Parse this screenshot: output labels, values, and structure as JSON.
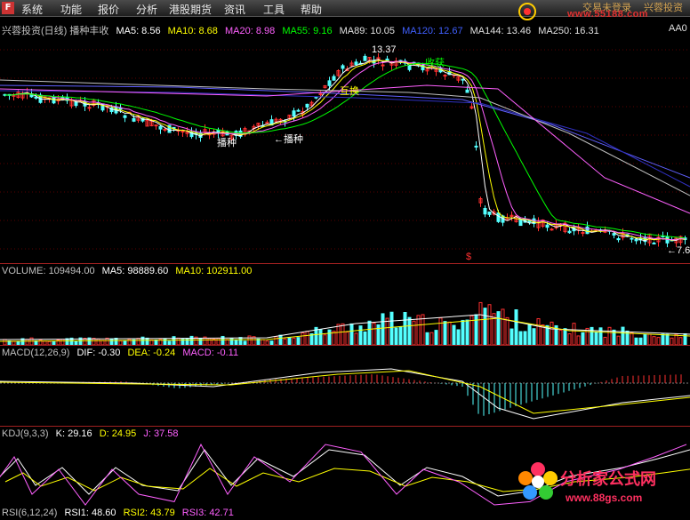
{
  "menu": {
    "logo_glyph": "F",
    "items": [
      "系统",
      "功能",
      "报价",
      "分析",
      "港股期货",
      "资讯",
      "工具",
      "帮助"
    ],
    "login_status": "交易未登录",
    "brand": "兴蓉投资"
  },
  "watermark_top_url": "www.55188.com",
  "price_legend": {
    "title": "兴蓉投资(日线) 播种丰收",
    "ma5": "MA5: 8.56",
    "ma10": "MA10: 8.68",
    "ma20": "MA20: 8.98",
    "ma55": "MA55: 9.16",
    "ma89": "MA89: 10.05",
    "ma120": "MA120: 12.67",
    "ma144": "MA144: 13.46",
    "ma250": "MA250: 16.31",
    "right_tag": "AA0"
  },
  "price_annotations": {
    "peak_price": "13.37",
    "harvest": "收获",
    "harvest2": "收获",
    "trade": "互换",
    "sow": "播种",
    "sow2": "←播种",
    "low_price": "←7.6"
  },
  "volume_legend": {
    "label": "VOLUME: 109494.00",
    "ma5": "MA5: 98889.60",
    "ma10": "MA10: 102911.00"
  },
  "macd_legend": {
    "label": "MACD(12,26,9)",
    "dif": "DIF: -0.30",
    "dea": "DEA: -0.24",
    "macd": "MACD: -0.11"
  },
  "kdj_legend": {
    "label": "KDJ(9,3,3)",
    "k": "K: 29.16",
    "d": "D: 24.95",
    "j": "J: 37.58"
  },
  "rsi_legend": {
    "label": "RSI(6,12,24)",
    "rsi1": "RSI1: 48.60",
    "rsi2": "RSI2: 43.79",
    "rsi3": "RSI3: 42.71"
  },
  "bottom_logo": {
    "brand": "分析家公式网",
    "url": "www.88gs.com"
  },
  "colors": {
    "up": "#ff3030",
    "down": "#54ffff",
    "ma5": "#ffffff",
    "ma10": "#ffff00",
    "ma20": "#ff60ff",
    "ma55": "#00ff00",
    "ma89": "#6060ff",
    "ma120": "#ff8000",
    "ma144": "#c0c0c0",
    "ma250": "#00c0c0",
    "grid_red": "#a02020"
  }
}
